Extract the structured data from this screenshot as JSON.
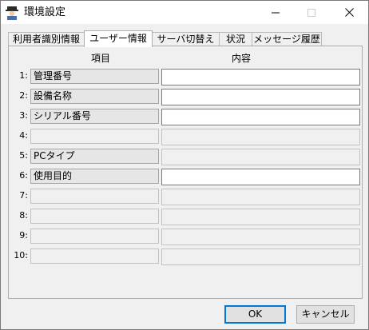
{
  "window": {
    "title": "環境設定"
  },
  "tabs": [
    {
      "label": "利用者識別情報",
      "active": false
    },
    {
      "label": "ユーザー情報",
      "active": true
    },
    {
      "label": "サーバ切替え",
      "active": false
    },
    {
      "label": "状況",
      "active": false
    },
    {
      "label": "メッセージ履歴",
      "active": false
    }
  ],
  "columns": {
    "item": "項目",
    "content": "内容"
  },
  "rows": [
    {
      "num": "1:",
      "item": "管理番号",
      "content": "",
      "enabled": true
    },
    {
      "num": "2:",
      "item": "設備名称",
      "content": "",
      "enabled": true
    },
    {
      "num": "3:",
      "item": "シリアル番号",
      "content": "",
      "enabled": true
    },
    {
      "num": "4:",
      "item": "",
      "content": "",
      "enabled": false
    },
    {
      "num": "5:",
      "item": "PCタイプ",
      "content": "",
      "enabled": false
    },
    {
      "num": "6:",
      "item": "使用目的",
      "content": "",
      "enabled": true
    },
    {
      "num": "7:",
      "item": "",
      "content": "",
      "enabled": false
    },
    {
      "num": "8:",
      "item": "",
      "content": "",
      "enabled": false
    },
    {
      "num": "9:",
      "item": "",
      "content": "",
      "enabled": false
    },
    {
      "num": "10:",
      "item": "",
      "content": "",
      "enabled": false
    }
  ],
  "buttons": {
    "ok": "OK",
    "cancel": "キャンセル"
  },
  "icons": {
    "app": "settings-user-icon",
    "minimize": "minimize-icon",
    "maximize": "maximize-icon",
    "close": "close-icon"
  }
}
